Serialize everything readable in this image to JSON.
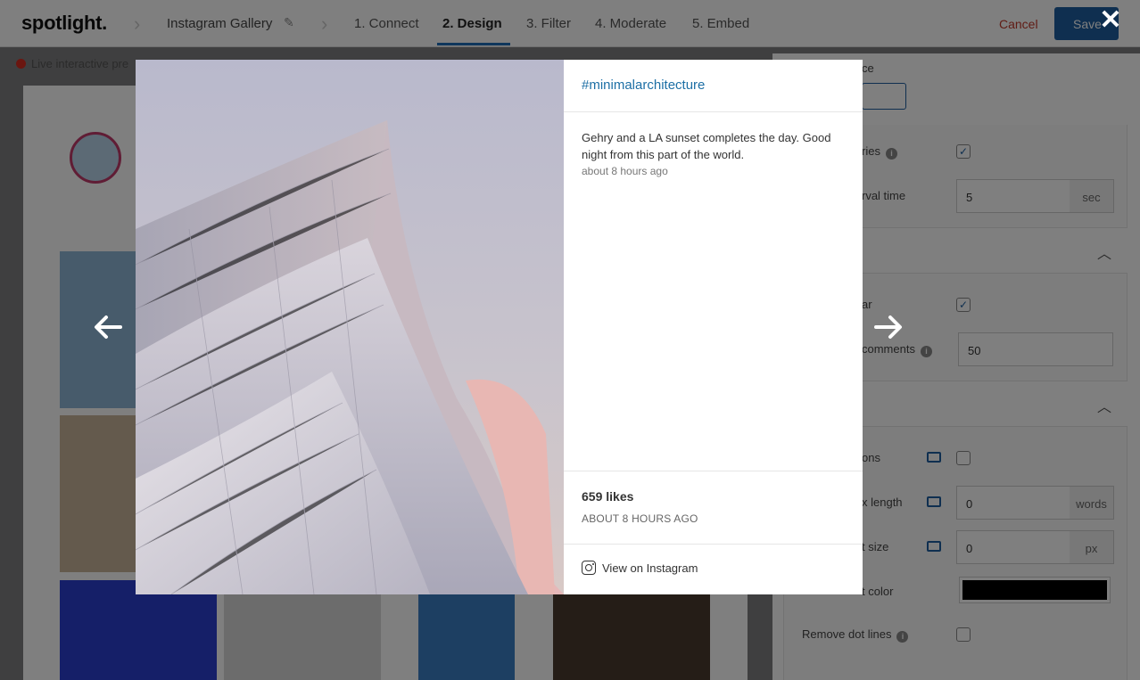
{
  "app": {
    "logo": "spotlight.",
    "gallery_name": "Instagram Gallery",
    "steps": [
      {
        "label": "1. Connect"
      },
      {
        "label": "2. Design"
      },
      {
        "label": "3. Filter"
      },
      {
        "label": "4. Moderate"
      },
      {
        "label": "5. Embed"
      }
    ],
    "active_step": "2. Design",
    "cancel_label": "Cancel",
    "save_label": "Save",
    "live_preview_label": "Live interactive pre"
  },
  "settings": {
    "device_label": "ce",
    "rows": [
      {
        "label": "ries",
        "checked": true
      },
      {
        "label": "rval time",
        "value": "5",
        "unit": "sec"
      },
      {
        "label": "ar",
        "checked": true
      },
      {
        "label": "comments",
        "value": "50"
      },
      {
        "label": "ons",
        "checked": false
      },
      {
        "label": "x length",
        "value": "0",
        "unit": "words"
      },
      {
        "label": "t size",
        "value": "0",
        "unit": "px"
      },
      {
        "label": "t color",
        "color": "#000000"
      },
      {
        "label": "Remove dot lines",
        "checked": false
      }
    ]
  },
  "lightbox": {
    "hashtag": "#minimalarchitecture",
    "caption": "Gehry and a LA sunset completes the day. Good night from this part of the world.",
    "caption_time": "about 8 hours ago",
    "likes": "659 likes",
    "footer_time": "ABOUT 8 HOURS AGO",
    "view_link": "View on Instagram",
    "close_icon": "close-icon",
    "prev_icon": "arrow-left-icon",
    "next_icon": "arrow-right-icon"
  },
  "colors": {
    "accent": "#1e5fa0",
    "hashtag": "#1d6fa5",
    "live_dot": "#d62d20",
    "cancel": "#c0392b"
  }
}
